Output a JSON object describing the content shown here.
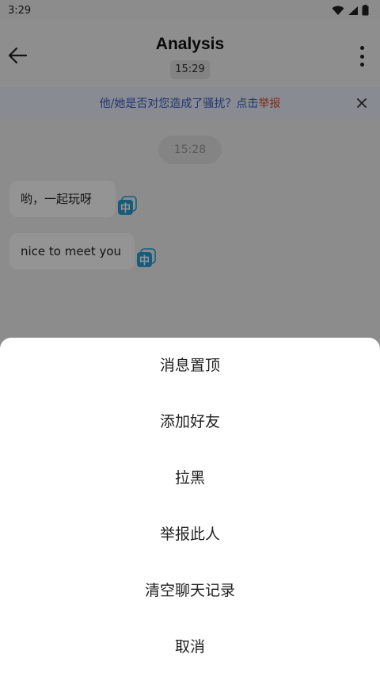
{
  "status_bar": {
    "time": "3:29"
  },
  "header": {
    "title": "Analysis",
    "time_badge": "15:29"
  },
  "notice": {
    "text": "他/她是否对您造成了骚扰？点击",
    "link": "举报"
  },
  "chat": {
    "timestamp": "15:28",
    "messages": [
      {
        "text": "哟，一起玩呀",
        "translate_icon": "中"
      },
      {
        "text": "nice to meet you",
        "translate_icon": "中"
      }
    ]
  },
  "action_sheet": {
    "items": [
      "消息置顶",
      "添加好友",
      "拉黑",
      "举报此人",
      "清空聊天记录",
      "取消"
    ]
  },
  "colors": {
    "notice_text": "#3a5cc4",
    "notice_link": "#e0452b",
    "translate_icon": "#2a9fd6"
  }
}
